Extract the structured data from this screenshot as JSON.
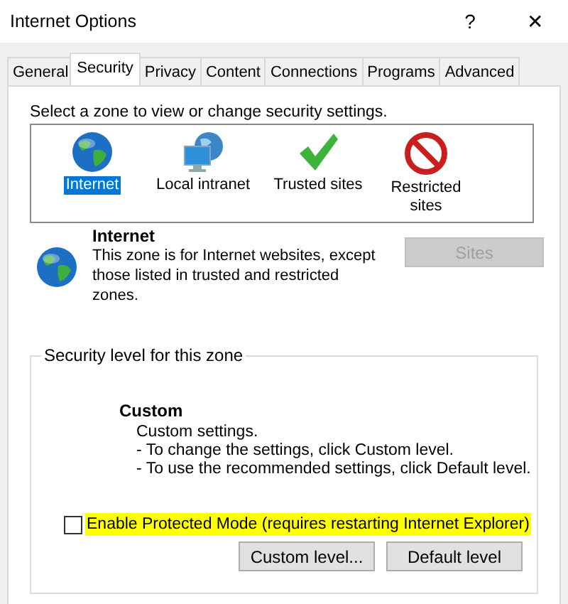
{
  "window": {
    "title": "Internet Options",
    "help": "?",
    "close": "✕"
  },
  "tabs": [
    {
      "label": "General",
      "selected": false
    },
    {
      "label": "Security",
      "selected": true
    },
    {
      "label": "Privacy",
      "selected": false
    },
    {
      "label": "Content",
      "selected": false
    },
    {
      "label": "Connections",
      "selected": false
    },
    {
      "label": "Programs",
      "selected": false
    },
    {
      "label": "Advanced",
      "selected": false
    }
  ],
  "zone_prompt": "Select a zone to view or change security settings.",
  "zones": [
    {
      "kind": "globe",
      "label": "Internet",
      "selected": true
    },
    {
      "kind": "intranet",
      "label": "Local intranet",
      "selected": false
    },
    {
      "kind": "check",
      "label": "Trusted sites",
      "selected": false
    },
    {
      "kind": "blocked",
      "label": "Restricted sites",
      "selected": false
    }
  ],
  "zone_info": {
    "title": "Internet",
    "description": "This zone is for Internet websites, except those listed in trusted and restricted zones.",
    "sites_button": {
      "label": "Sites",
      "disabled": true
    }
  },
  "security_level": {
    "legend": "Security level for this zone",
    "level_name": "Custom",
    "lines": [
      "Custom settings.",
      "- To change the settings, click Custom level.",
      "- To use the recommended settings, click Default level."
    ]
  },
  "protected_mode": {
    "label": "Enable Protected Mode (requires restarting Internet Explorer)",
    "checked": false,
    "highlighted": true
  },
  "buttons": [
    "Custom level...",
    "Default level"
  ]
}
